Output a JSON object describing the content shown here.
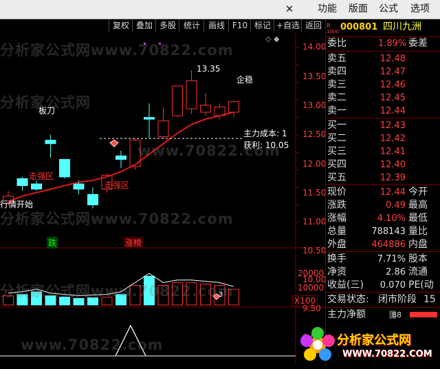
{
  "menu": {
    "items": [
      "功能",
      "版面",
      "公式",
      "选项"
    ],
    "close_icon": "close-icon"
  },
  "toolbar": {
    "buttons": [
      "复权",
      "叠加",
      "多股",
      "统计",
      "画线",
      "F10",
      "标记",
      "+自选",
      "返回"
    ],
    "chevrons": "◇ ◆"
  },
  "stock": {
    "market_badge_top": "R",
    "market_badge_bottom": "1000",
    "code": "000801",
    "name": "四川九洲"
  },
  "weibi": {
    "label": "委比",
    "value": "1.89%",
    "label2": "委差"
  },
  "sell_levels": [
    {
      "label": "卖五",
      "price": "12.48"
    },
    {
      "label": "卖四",
      "price": "12.47"
    },
    {
      "label": "卖三",
      "price": "12.46"
    },
    {
      "label": "卖二",
      "price": "12.45"
    },
    {
      "label": "卖一",
      "price": "12.44"
    }
  ],
  "buy_levels": [
    {
      "label": "买一",
      "price": "12.43"
    },
    {
      "label": "买二",
      "price": "12.42"
    },
    {
      "label": "买三",
      "price": "12.41"
    },
    {
      "label": "买四",
      "price": "12.40"
    },
    {
      "label": "买五",
      "price": "12.39"
    }
  ],
  "quote": [
    {
      "label": "现价",
      "value": "12.44",
      "label2": "今开",
      "color": "#ff4040"
    },
    {
      "label": "涨跌",
      "value": "0.49",
      "label2": "最高",
      "color": "#ff4040"
    },
    {
      "label": "涨幅",
      "value": "4.10%",
      "label2": "最低",
      "color": "#ff4040"
    },
    {
      "label": "总量",
      "value": "788143",
      "label2": "量比",
      "color": "#e0e0e0"
    },
    {
      "label": "外盘",
      "value": "464886",
      "label2": "内盘",
      "color": "#ff4040"
    }
  ],
  "stats": [
    {
      "label": "换手",
      "value": "7.71%",
      "label2": "股本"
    },
    {
      "label": "净资",
      "value": "2.86",
      "label2": "流通"
    },
    {
      "label": "收益(三)",
      "value": "0.070",
      "label2": "PE(动"
    }
  ],
  "status": {
    "label": "交易状态:",
    "value": "闭市阶段",
    "extra": "15"
  },
  "main_net": {
    "label": "主力净额",
    "value": "88"
  },
  "chart_data": {
    "type": "candlestick",
    "price_axis": {
      "ticks": [
        "14.00",
        "13.50",
        "13.00",
        "12.50",
        "12.00",
        "11.50",
        "11.00",
        "10.50",
        "10.00",
        "9.50",
        "9.00"
      ],
      "ylim": [
        9.0,
        14.0
      ]
    },
    "volume_axis": {
      "ticks": [
        "20000",
        "10000"
      ],
      "multiplier": "X100"
    },
    "candles": [
      {
        "o": 9.55,
        "c": 9.75,
        "h": 9.9,
        "l": 9.5
      },
      {
        "o": 10.25,
        "c": 10.05,
        "h": 10.3,
        "l": 9.9
      },
      {
        "o": 10.1,
        "c": 9.95,
        "h": 10.2,
        "l": 9.9
      },
      {
        "o": 11.35,
        "c": 11.25,
        "h": 11.5,
        "l": 10.85
      },
      {
        "o": 10.8,
        "c": 10.3,
        "h": 10.8,
        "l": 10.25
      },
      {
        "o": 10.1,
        "c": 9.95,
        "h": 10.2,
        "l": 9.8
      },
      {
        "o": 9.8,
        "c": 9.5,
        "h": 10.0,
        "l": 9.4
      },
      {
        "o": 9.95,
        "c": 10.35,
        "h": 10.4,
        "l": 9.85
      },
      {
        "o": 10.9,
        "c": 10.8,
        "h": 11.05,
        "l": 10.55
      },
      {
        "o": 10.6,
        "c": 11.35,
        "h": 11.4,
        "l": 10.5
      },
      {
        "o": 12.0,
        "c": 11.95,
        "h": 12.4,
        "l": 11.4
      },
      {
        "o": 11.45,
        "c": 11.9,
        "h": 12.3,
        "l": 11.4
      },
      {
        "o": 12.05,
        "c": 12.9,
        "h": 12.9,
        "l": 12.0
      },
      {
        "o": 12.25,
        "c": 13.05,
        "h": 13.35,
        "l": 12.1
      },
      {
        "o": 12.15,
        "c": 12.35,
        "h": 12.7,
        "l": 12.05
      },
      {
        "o": 12.05,
        "c": 12.3,
        "h": 12.4,
        "l": 11.95
      },
      {
        "o": 12.15,
        "c": 12.45,
        "h": 12.5,
        "l": 12.0
      }
    ],
    "annotations": {
      "high": "13.35",
      "kbar_label": "板刀",
      "stable_label": "企稳",
      "strong_zone_1": "走强区",
      "strong_zone_2": "走强区",
      "start_label": "行情开始",
      "cost_label": "主力成本: 1",
      "profit_label": "获利: 10.05",
      "fall_tag": "跌",
      "rise_tag": "涨榜",
      "volume_count": "3"
    },
    "volume": [
      0.7,
      0.8,
      1.0,
      0.7,
      0.6,
      0.5,
      0.55,
      0.6,
      0.8,
      1.5,
      2.2,
      1.5,
      1.7,
      1.7,
      1.6,
      1.5,
      1.2
    ]
  },
  "watermark": {
    "text1": "分析家公式网www.70822.com",
    "text2": "分析家公式网",
    "text3": "www.70822.com"
  },
  "logo": {
    "brand": "分析家公式网",
    "url": "WWW.70822.COM"
  },
  "colors": {
    "up": "#ff3030",
    "down": "#54ffff",
    "ma": "#e01a1a",
    "panel_border": "#7a0000",
    "price_text": "#ff4040"
  }
}
